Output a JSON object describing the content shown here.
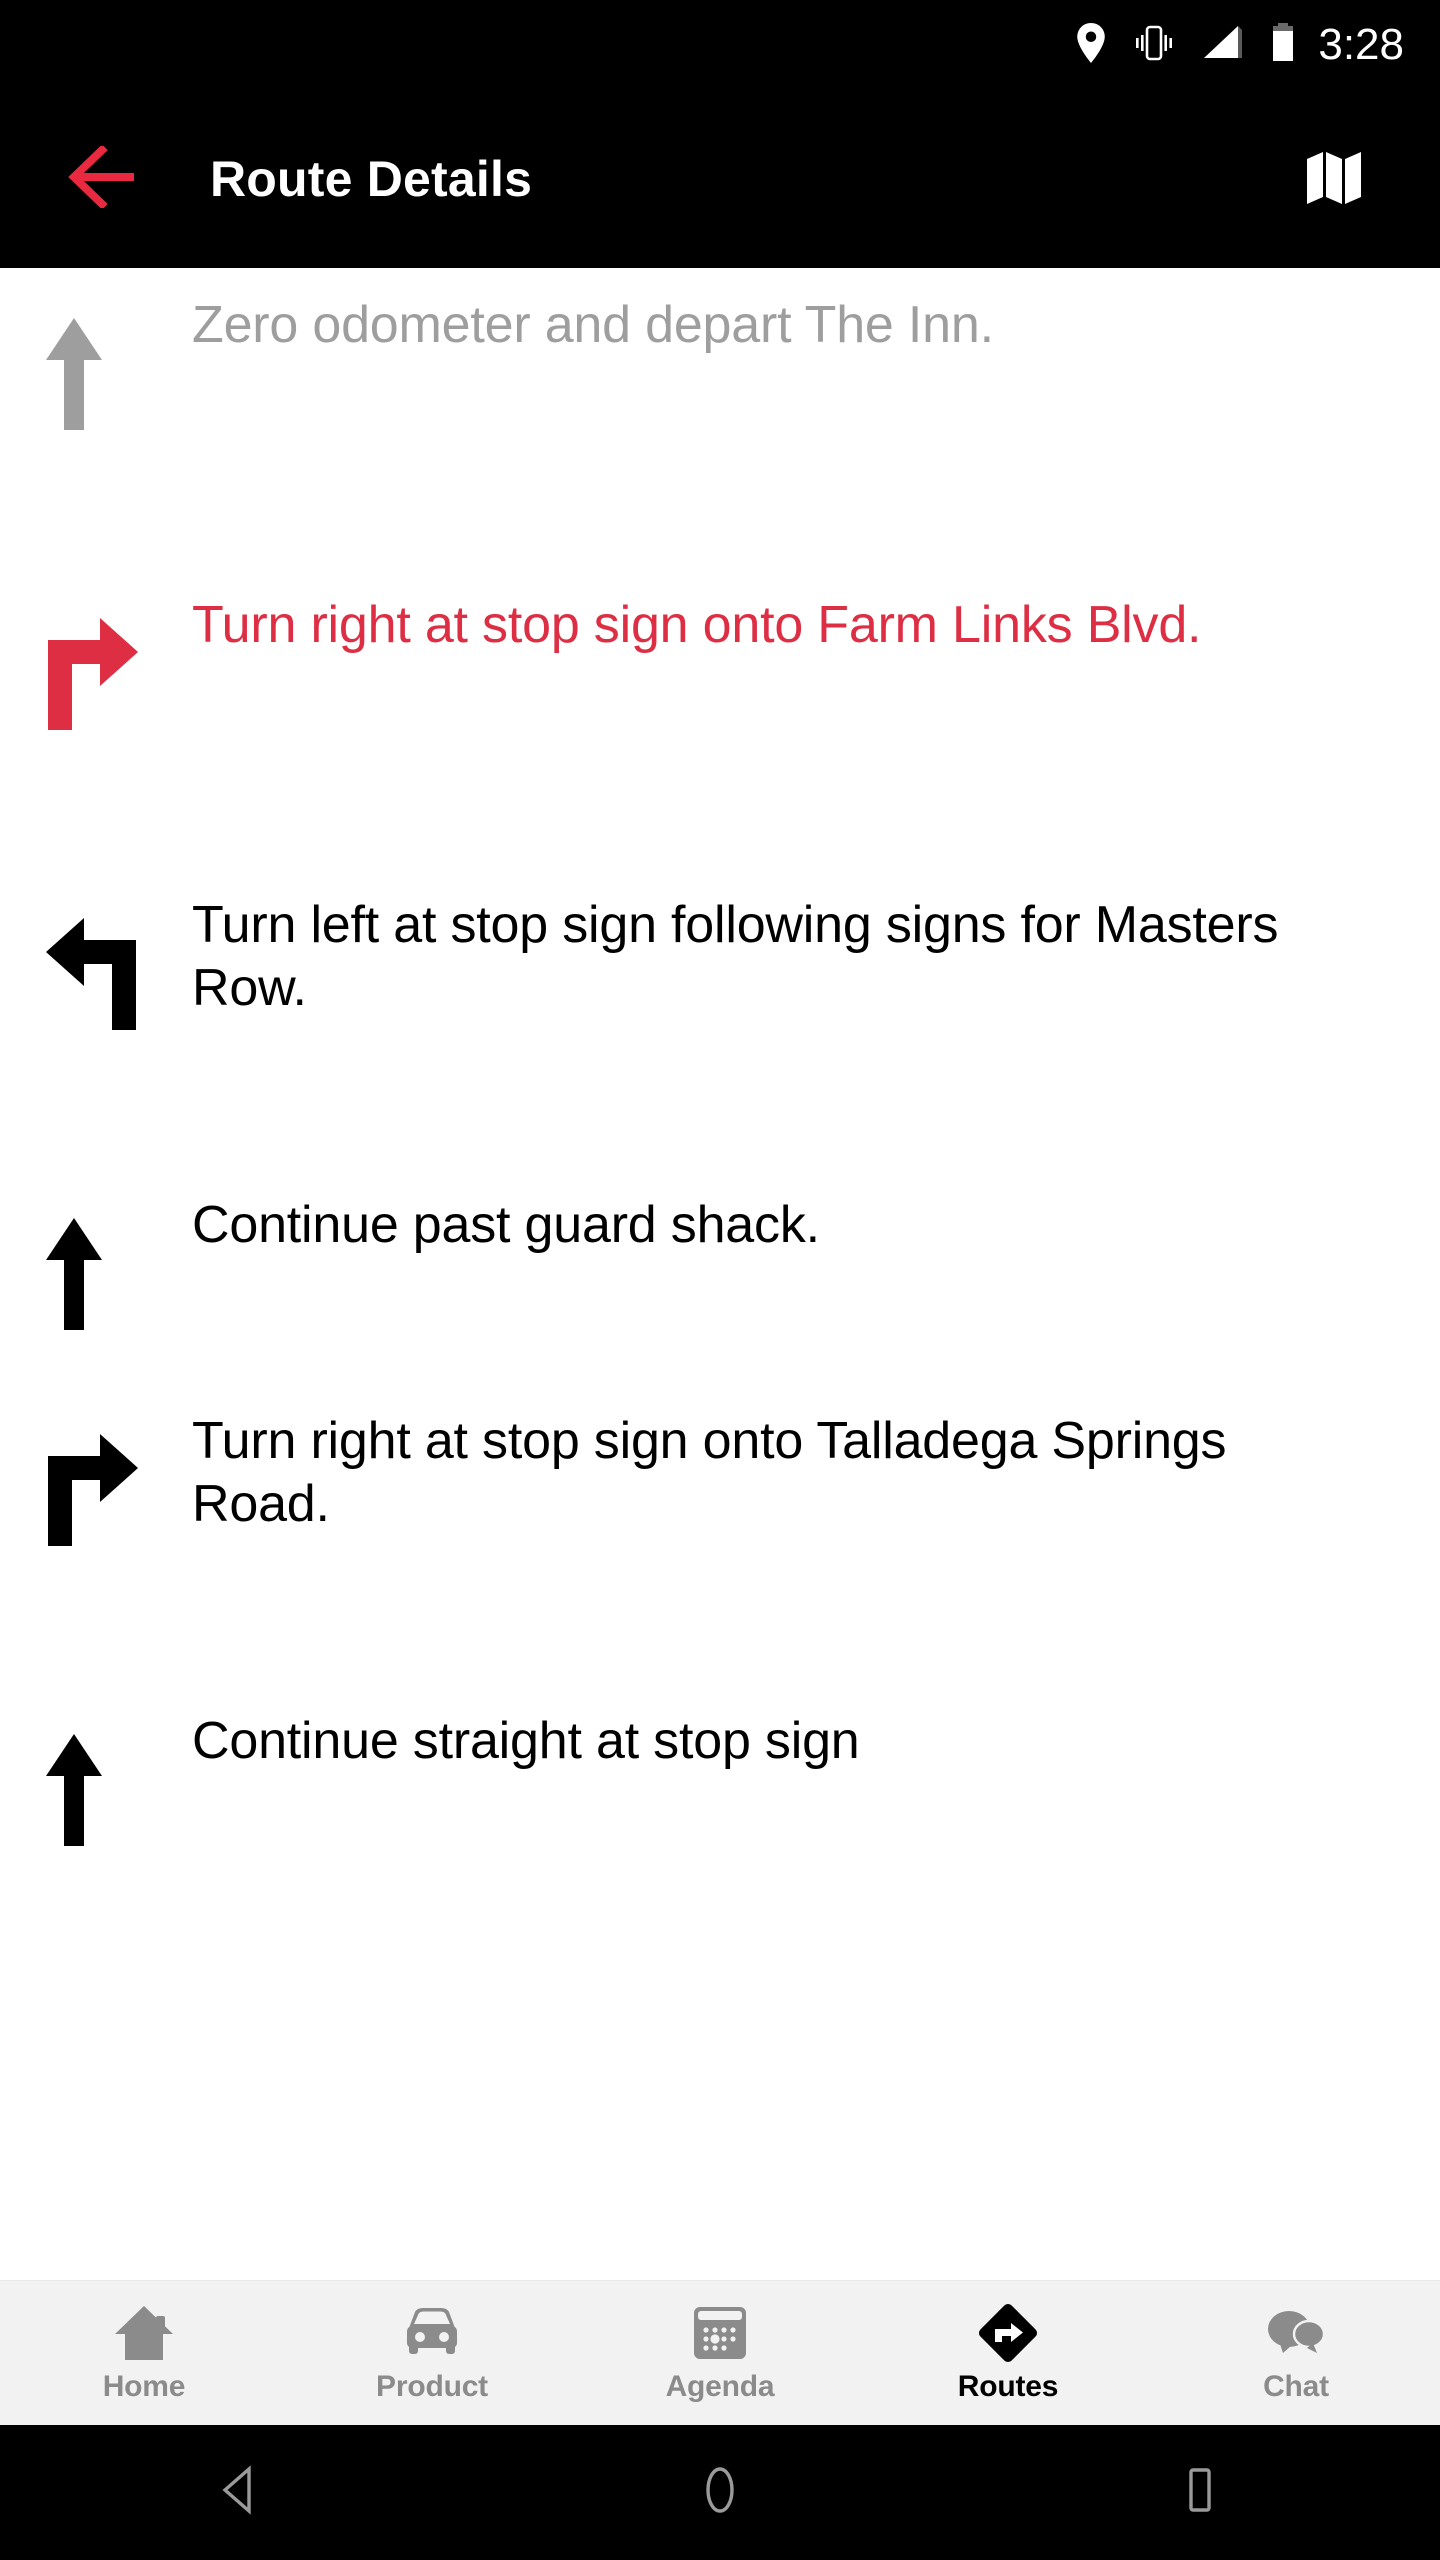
{
  "status_bar": {
    "time": "3:28",
    "icons": [
      "location-pin-icon",
      "vibrate-icon",
      "signal-icon",
      "battery-icon"
    ]
  },
  "app_bar": {
    "title": "Route Details",
    "back_icon": "back-arrow-icon",
    "map_icon": "map-icon",
    "back_color": "#e8293f",
    "background": "#000000"
  },
  "directions": {
    "steps": [
      {
        "text": "Zero odometer and depart The Inn.",
        "icon": "arrow-straight-icon",
        "state": "past",
        "color": "#9e9e9e",
        "lines": 2
      },
      {
        "text": "Turn right at stop sign onto Farm Links Blvd.",
        "icon": "arrow-turn-right-icon",
        "state": "active",
        "color": "#dd2e44",
        "lines": 2
      },
      {
        "text": "Turn left at stop sign following signs for Masters Row.",
        "icon": "arrow-turn-left-icon",
        "state": "next",
        "color": "#000000",
        "lines": 2
      },
      {
        "text": "Continue past guard shack.",
        "icon": "arrow-straight-icon",
        "state": "next",
        "color": "#000000",
        "lines": 1
      },
      {
        "text": "Turn right at stop sign onto Talladega Springs Road.",
        "icon": "arrow-turn-right-icon",
        "state": "next",
        "color": "#000000",
        "lines": 2
      },
      {
        "text": "Continue straight at stop sign",
        "icon": "arrow-straight-icon",
        "state": "next",
        "color": "#000000",
        "lines": 1
      }
    ]
  },
  "tab_bar": {
    "background": "#f2f2f2",
    "inactive_color": "#8b8b8b",
    "active_color": "#000000",
    "tabs": [
      {
        "label": "Home",
        "icon": "home-icon",
        "selected": false
      },
      {
        "label": "Product",
        "icon": "car-icon",
        "selected": false
      },
      {
        "label": "Agenda",
        "icon": "calendar-icon",
        "selected": false
      },
      {
        "label": "Routes",
        "icon": "directions-icon",
        "selected": true
      },
      {
        "label": "Chat",
        "icon": "chat-bubbles-icon",
        "selected": false
      }
    ]
  },
  "system_nav": {
    "buttons": [
      {
        "name": "back-triangle-icon"
      },
      {
        "name": "home-circle-icon"
      },
      {
        "name": "recents-square-icon"
      }
    ]
  }
}
